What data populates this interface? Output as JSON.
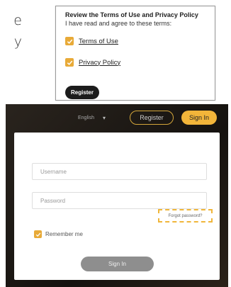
{
  "side_text": [
    "e",
    "y"
  ],
  "terms": {
    "title": "Review the Terms of Use and Privacy Policy",
    "subtitle": "I have read and agree to these terms:",
    "items": [
      {
        "label": "Terms of Use",
        "checked": true
      },
      {
        "label": "Privacy Policy",
        "checked": true
      }
    ],
    "register_label": "Register"
  },
  "header": {
    "language": "English",
    "register_label": "Register",
    "signin_label": "Sign In"
  },
  "login": {
    "username_placeholder": "Username",
    "password_placeholder": "Password",
    "forgot_label": "Forgot password?",
    "remember_label": "Remember me",
    "remember_checked": true,
    "signin_label": "Sign In"
  },
  "colors": {
    "accent": "#f2b53a",
    "dark_bg": "#15120f",
    "highlight_dash": "#f0b63a"
  }
}
